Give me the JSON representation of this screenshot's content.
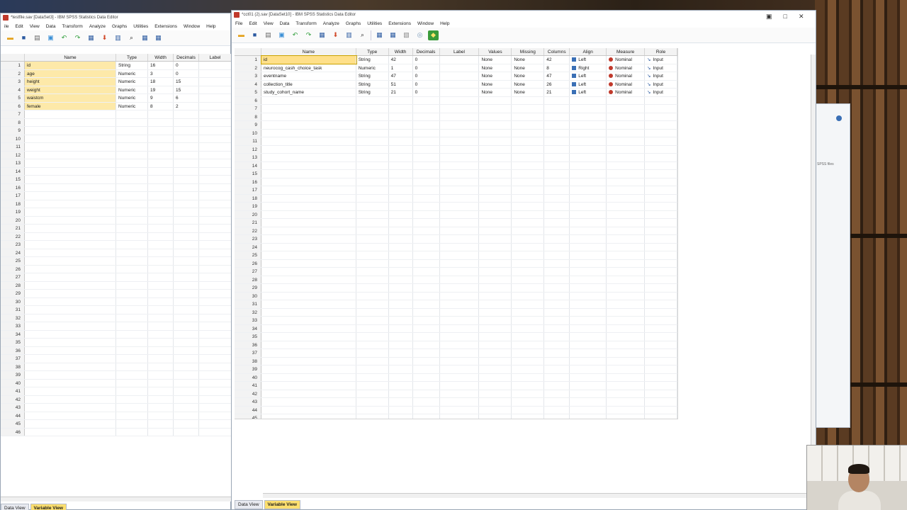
{
  "left_window": {
    "title": "*testfile.sav [DataSet3] - IBM SPSS Statistics Data Editor",
    "menu": [
      "ile",
      "Edit",
      "View",
      "Data",
      "Transform",
      "Analyze",
      "Graphs",
      "Utilities",
      "Extensions",
      "Window",
      "Help"
    ],
    "columns": [
      "Name",
      "Type",
      "Width",
      "Decimals",
      "Label"
    ],
    "rows": [
      {
        "n": "1",
        "name": "id",
        "type": "String",
        "width": "16",
        "decimals": "0"
      },
      {
        "n": "2",
        "name": "age",
        "type": "Numeric",
        "width": "3",
        "decimals": "0"
      },
      {
        "n": "3",
        "name": "height",
        "type": "Numeric",
        "width": "18",
        "decimals": "15"
      },
      {
        "n": "4",
        "name": "weight",
        "type": "Numeric",
        "width": "19",
        "decimals": "15"
      },
      {
        "n": "5",
        "name": "waistcm",
        "type": "Numeric",
        "width": "9",
        "decimals": "6"
      },
      {
        "n": "6",
        "name": "female",
        "type": "Numeric",
        "width": "8",
        "decimals": "2"
      }
    ],
    "row_count": 46,
    "tabs": [
      "Data View",
      "Variable View"
    ],
    "active_tab": "Variable View"
  },
  "right_window": {
    "title": "*cct01 (2).sav [DataSet10] - IBM SPSS Statistics Data Editor",
    "menu": [
      "File",
      "Edit",
      "View",
      "Data",
      "Transform",
      "Analyze",
      "Graphs",
      "Utilities",
      "Extensions",
      "Window",
      "Help"
    ],
    "columns": [
      "Name",
      "Type",
      "Width",
      "Decimals",
      "Label",
      "Values",
      "Missing",
      "Columns",
      "Align",
      "Measure",
      "Role"
    ],
    "rows": [
      {
        "n": "1",
        "name": "id",
        "type": "String",
        "width": "42",
        "decimals": "0",
        "label": "",
        "values": "None",
        "missing": "None",
        "columns": "42",
        "align": "Left",
        "measure": "Nominal",
        "role": "Input"
      },
      {
        "n": "2",
        "name": "neurocog_cash_choice_task",
        "type": "Numeric",
        "width": "1",
        "decimals": "0",
        "label": "",
        "values": "None",
        "missing": "None",
        "columns": "8",
        "align": "Right",
        "measure": "Nominal",
        "role": "Input"
      },
      {
        "n": "3",
        "name": "eventname",
        "type": "String",
        "width": "47",
        "decimals": "0",
        "label": "",
        "values": "None",
        "missing": "None",
        "columns": "47",
        "align": "Left",
        "measure": "Nominal",
        "role": "Input"
      },
      {
        "n": "4",
        "name": "collection_title",
        "type": "String",
        "width": "51",
        "decimals": "0",
        "label": "",
        "values": "None",
        "missing": "None",
        "columns": "26",
        "align": "Left",
        "measure": "Nominal",
        "role": "Input"
      },
      {
        "n": "5",
        "name": "study_cohort_name",
        "type": "String",
        "width": "21",
        "decimals": "0",
        "label": "",
        "values": "None",
        "missing": "None",
        "columns": "21",
        "align": "Left",
        "measure": "Nominal",
        "role": "Input"
      }
    ],
    "row_count": 45,
    "tabs": [
      "Data View",
      "Variable View"
    ],
    "active_tab": "Variable View",
    "colors": {
      "measure_icon": "#c0392b",
      "align_icon": "#3a6fb5",
      "role_icon": "#2b5aa0"
    }
  },
  "side_panel": {
    "label": "SPSS files"
  }
}
